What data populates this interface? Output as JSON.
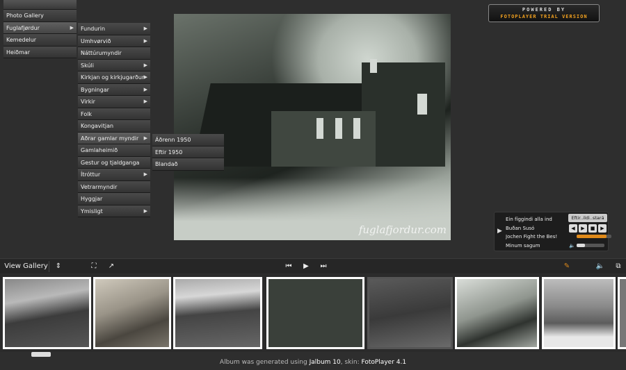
{
  "powered": {
    "line1": "POWERED BY",
    "line2": "FOTOPLAYER TRIAL VERSION"
  },
  "menu_main": [
    "Photo Gallery",
    "Fuglafjørdur",
    "Kemedelur",
    "Heiðmar"
  ],
  "menu_sub": [
    {
      "label": "Fundurin",
      "arrow": "▶"
    },
    {
      "label": "Umhvørvið",
      "arrow": "▶"
    },
    {
      "label": "Náttúrumyndir",
      "arrow": ""
    },
    {
      "label": "Skúli",
      "arrow": "▶"
    },
    {
      "label": "Kirkjan og kirkjugarður",
      "arrow": "▶"
    },
    {
      "label": "Bygningar",
      "arrow": "▶"
    },
    {
      "label": "Virkir",
      "arrow": "▶"
    },
    {
      "label": "Folk",
      "arrow": ""
    },
    {
      "label": "Kongavitjan",
      "arrow": ""
    },
    {
      "label": "Aðrar gamlar myndir",
      "arrow": "▶"
    },
    {
      "label": "Gamlaheimið",
      "arrow": ""
    },
    {
      "label": "Gestur og tjaldganga",
      "arrow": ""
    },
    {
      "label": "Ítróttur",
      "arrow": "▶"
    },
    {
      "label": "Vetrarmyndir",
      "arrow": ""
    },
    {
      "label": "Hyggjar",
      "arrow": ""
    },
    {
      "label": "Ymisligt",
      "arrow": "▶"
    }
  ],
  "menu_third": [
    "Áðrenn 1950",
    "Eftir 1950",
    "Blandað"
  ],
  "photo_watermark": "fuglafjordur.com",
  "music": {
    "tracks": [
      "Ein fíggindi alla ind",
      "Buðan Susó",
      "Jochen Fight the Bes!",
      "Minum sagum"
    ],
    "now_playing": "Eftir..ildi..stará"
  },
  "toolbar": {
    "view_gallery": "View Gallery",
    "icons": {
      "fit": "⛶",
      "share": "↗",
      "prev": "⏮",
      "play": "▶",
      "next": "⏭",
      "notes": "✎",
      "sound": "🔈",
      "fullscreen": "⧉",
      "gallery_arrows": "⇕"
    }
  },
  "thumbs_count": 8,
  "footer": {
    "prefix": "Album was generated using ",
    "app": "Jalbum 10",
    "middle": ", skin: ",
    "skin": "FotoPlayer 4.1"
  },
  "colors": {
    "accent": "#e08a1a",
    "bg": "#2e2e2e"
  }
}
